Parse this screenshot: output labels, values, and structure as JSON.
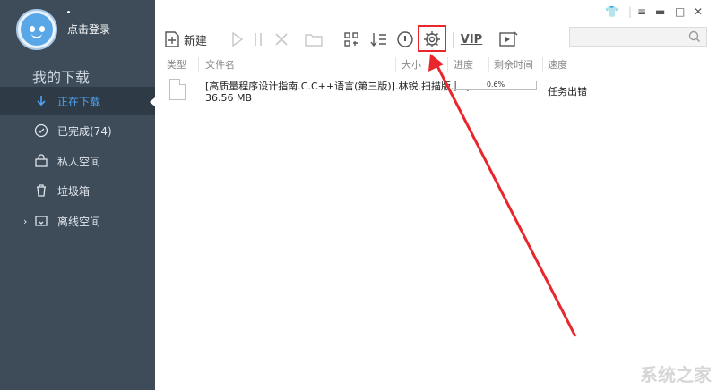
{
  "user": {
    "login_label": "点击登录"
  },
  "sidebar": {
    "section_title": "我的下载",
    "items": [
      {
        "label": "正在下载",
        "icon": "download-icon"
      },
      {
        "label": "已完成(74)",
        "icon": "check-circle-icon"
      },
      {
        "label": "私人空间",
        "icon": "lock-box-icon"
      },
      {
        "label": "垃圾箱",
        "icon": "trash-icon"
      },
      {
        "label": "离线空间",
        "icon": "cloud-folder-icon"
      }
    ]
  },
  "toolbar": {
    "new_label": "新建",
    "vip_label": "VIP",
    "search_placeholder": ""
  },
  "columns": [
    "类型",
    "文件名",
    "大小",
    "进度",
    "剩余时间",
    "速度"
  ],
  "downloads": [
    {
      "name": "[高质量程序设计指南.C.C++语言(第三版)].林锐.扫描版.php",
      "size": "36.56 MB",
      "progress_text": "0.6%",
      "progress": 0.006,
      "status": "任务出错"
    }
  ],
  "colors": {
    "sidebar_bg": "#3e4c5a",
    "accent": "#4fa3f0",
    "highlight": "#e8262c"
  },
  "watermark": "系统之家"
}
